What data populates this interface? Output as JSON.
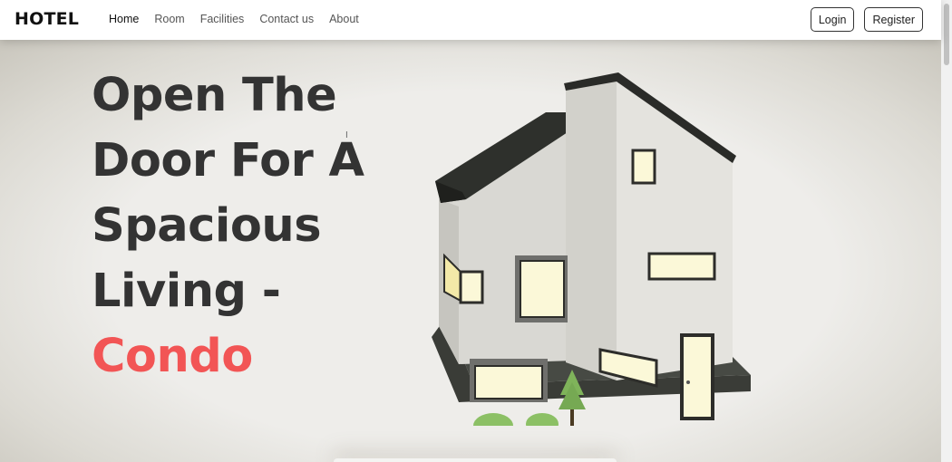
{
  "navbar": {
    "brand": "HOTEL",
    "links": [
      {
        "label": "Home",
        "active": true
      },
      {
        "label": "Room",
        "active": false
      },
      {
        "label": "Facilities",
        "active": false
      },
      {
        "label": "Contact us",
        "active": false
      },
      {
        "label": "About",
        "active": false
      }
    ],
    "login_label": "Login",
    "register_label": "Register"
  },
  "hero": {
    "title_lines": [
      "Open The",
      "Door For A",
      "Spacious",
      "Living -"
    ],
    "accent_word": "Condo",
    "accent_color": "#f25555",
    "image": "house-3d-illustration"
  }
}
